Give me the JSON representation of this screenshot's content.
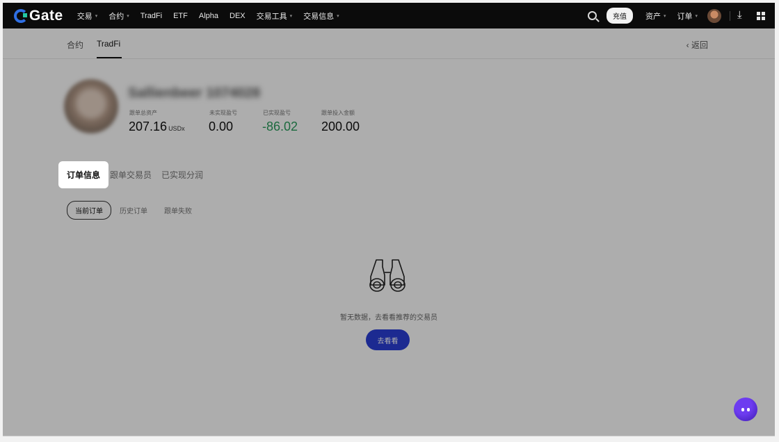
{
  "nav": {
    "logo": "Gate",
    "items": [
      {
        "label": "交易",
        "dropdown": true
      },
      {
        "label": "合约",
        "dropdown": true
      },
      {
        "label": "TradFi",
        "dropdown": false
      },
      {
        "label": "ETF",
        "dropdown": false
      },
      {
        "label": "Alpha",
        "dropdown": false
      },
      {
        "label": "DEX",
        "dropdown": false
      },
      {
        "label": "交易工具",
        "dropdown": true
      },
      {
        "label": "交易信息",
        "dropdown": true
      }
    ],
    "deposit": "充值",
    "assets": "资产",
    "orders": "订单"
  },
  "subtabs": {
    "tab1": "合约",
    "tab2": "TradFi",
    "back": "返回"
  },
  "profile": {
    "name": "Sallienbeer 1074028",
    "stats": [
      {
        "label": "跟单总资产",
        "value": "207.16",
        "unit": "USDx"
      },
      {
        "label": "未实现盈亏",
        "value": "0.00",
        "unit": ""
      },
      {
        "label": "已实现盈亏",
        "value": "-86.02",
        "unit": ""
      },
      {
        "label": "跟单投入金额",
        "value": "200.00",
        "unit": ""
      }
    ]
  },
  "order_tabs": {
    "active": "订单信息",
    "tab2": "跟单交易员",
    "tab3": "已实现分润"
  },
  "filters": {
    "current": "当前订单",
    "history": "历史订单",
    "failed": "跟单失败"
  },
  "empty": {
    "text": "暂无数据，去看看推荐的交易员",
    "button": "去看看"
  },
  "colors": {
    "accent": "#2a3fd6",
    "negative": "#2a9d5c"
  }
}
